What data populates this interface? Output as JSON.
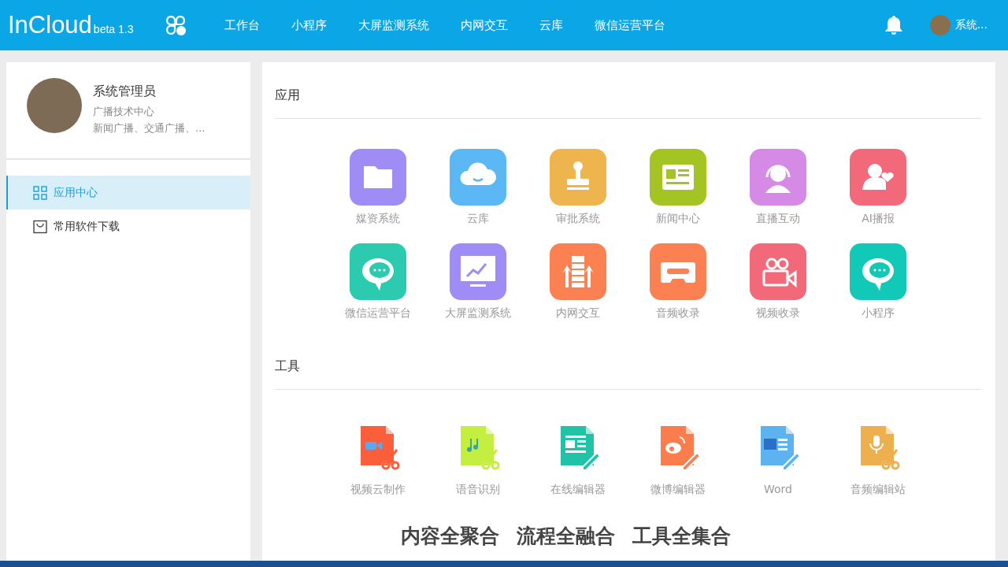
{
  "header": {
    "logo": "InCloud",
    "version": "beta 1.3",
    "nav": [
      {
        "label": "工作台"
      },
      {
        "label": "小程序"
      },
      {
        "label": "大屏监测系统"
      },
      {
        "label": "内网交互"
      },
      {
        "label": "云库"
      },
      {
        "label": "微信运营平台"
      }
    ],
    "user": "系统..."
  },
  "profile": {
    "name": "系统管理员",
    "department": "广播技术中心",
    "channels": "新闻广播、交通广播、..."
  },
  "sidebar": {
    "items": [
      {
        "label": "应用中心",
        "selected": true
      },
      {
        "label": "常用软件下载",
        "selected": false
      }
    ]
  },
  "sections": [
    {
      "title": "应用",
      "items": [
        {
          "label": "媒资系统",
          "color": "#a08cf5"
        },
        {
          "label": "云库",
          "color": "#5bb8f5"
        },
        {
          "label": "审批系统",
          "color": "#eeb44e"
        },
        {
          "label": "新闻中心",
          "color": "#a3c423"
        },
        {
          "label": "直播互动",
          "color": "#d58ae6"
        },
        {
          "label": "AI播报",
          "color": "#f2697a"
        },
        {
          "label": "微信运营平台",
          "color": "#2ccbb0"
        },
        {
          "label": "大屏监测系统",
          "color": "#a08cf5"
        },
        {
          "label": "内网交互",
          "color": "#fb8153"
        },
        {
          "label": "音频收录",
          "color": "#fb8153"
        },
        {
          "label": "视频收录",
          "color": "#f2697a"
        },
        {
          "label": "小程序",
          "color": "#12c9b7"
        }
      ]
    },
    {
      "title": "工具",
      "items": [
        {
          "label": "视频云制作",
          "color": "#fb5e3a"
        },
        {
          "label": "语音识别",
          "color": "#c4ee40"
        },
        {
          "label": "在线编辑器",
          "color": "#20c3a8"
        },
        {
          "label": "微博编辑器",
          "color": "#fb7d4e"
        },
        {
          "label": "Word",
          "color": "#5db2f0"
        },
        {
          "label": "音频编辑站",
          "color": "#eeb04e"
        }
      ]
    }
  ],
  "slogans": [
    "内容全聚合",
    "流程全融合",
    "工具全集合"
  ]
}
